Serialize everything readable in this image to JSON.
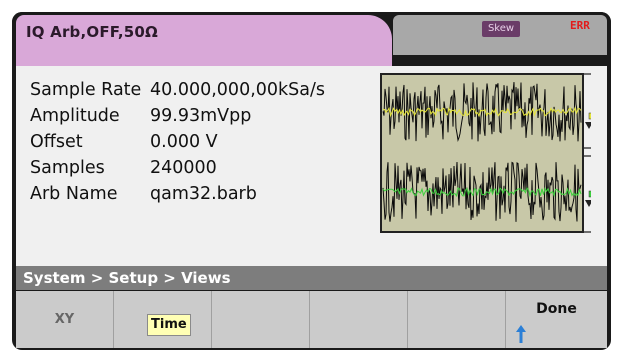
{
  "tab": {
    "title": "IQ Arb,OFF,50Ω"
  },
  "status": {
    "skew_label": "Skew",
    "err_label": "ERR"
  },
  "params": [
    {
      "label": "Sample Rate",
      "value": "40.000,000,00kSa/s"
    },
    {
      "label": "Amplitude",
      "value": "99.93mVpp"
    },
    {
      "label": "Offset",
      "value": "0.000 V"
    },
    {
      "label": "Samples",
      "value": "240000"
    },
    {
      "label": "Arb Name",
      "value": "qam32.barb"
    }
  ],
  "waveform": {
    "background": "#c8c8a8",
    "channel1_color": "#e6e63a",
    "channel2_color": "#3cd23c",
    "marker1_color": "#e6e63a",
    "marker2_color": "#3cd23c"
  },
  "breadcrumb": "System > Setup > Views",
  "softkeys": [
    {
      "label": "XY"
    },
    {
      "label": "Time"
    },
    {
      "label": ""
    },
    {
      "label": ""
    },
    {
      "label": ""
    },
    {
      "label": "Done"
    }
  ],
  "icons": {
    "done_arrow": "up-arrow-icon"
  },
  "colors": {
    "tab_active": "#d9a8d8",
    "breadcrumb_bg": "#7d7d7d",
    "arrow_blue": "#2b7fd6"
  }
}
